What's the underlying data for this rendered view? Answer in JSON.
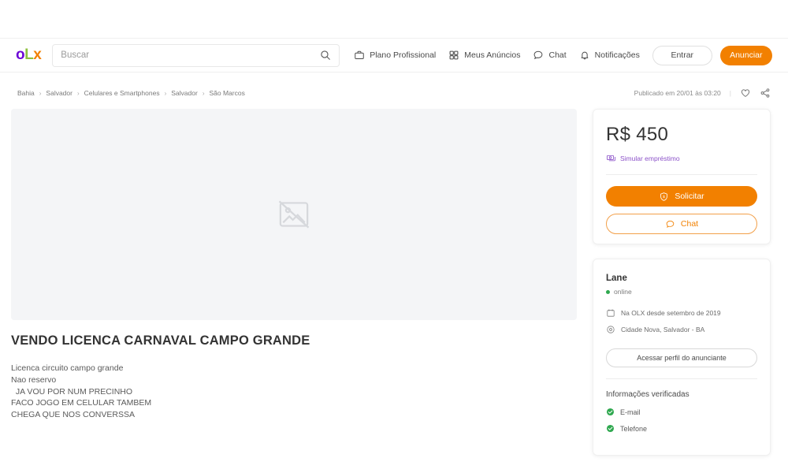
{
  "header": {
    "logo": {
      "part1": "o",
      "part2": "L",
      "part3": "x",
      "color1": "#6e0ad6",
      "color2": "#8ec13f",
      "color3": "#f28000"
    },
    "search": {
      "placeholder": "Buscar",
      "value": "",
      "icon": "search-icon"
    },
    "nav": [
      {
        "label": "Plano Profissional",
        "icon": "briefcase-icon"
      },
      {
        "label": "Meus Anúncios",
        "icon": "grid-icon"
      },
      {
        "label": "Chat",
        "icon": "chat-bubble-icon"
      },
      {
        "label": "Notificações",
        "icon": "bell-icon"
      }
    ],
    "login_label": "Entrar",
    "publish_label": "Anunciar",
    "publish_color": "#f28000"
  },
  "breadcrumb": {
    "items": [
      "Bahia",
      "Salvador",
      "Celulares e Smartphones",
      "Salvador",
      "São Marcos"
    ],
    "separator": "›"
  },
  "meta": {
    "published": "Publicado em 20/01 às 03:20",
    "divider": "|",
    "favorite_icon": "heart-icon",
    "share_icon": "share-icon"
  },
  "gallery": {
    "placeholder_icon": "broken-image-icon",
    "background": "#f4f5f7"
  },
  "ad": {
    "title": "VENDO LICENCA CARNAVAL CAMPO GRANDE",
    "description": "Licenca circuito campo grande\nNao reservo\n  JA VOU POR NUM PRECINHO\nFACO JOGO EM CELULAR TAMBEM\nCHEGA QUE NOS CONVERSSA"
  },
  "price_card": {
    "price": "R$ 450",
    "loan_link": "Simular empréstimo",
    "loan_icon": "money-icon",
    "loan_color": "#8c52c9",
    "request_label": "Solicitar",
    "request_icon": "shield-dollar-icon",
    "chat_label": "Chat",
    "chat_icon": "chat-bubble-icon"
  },
  "seller_card": {
    "name": "Lane",
    "status": "online",
    "status_color": "#2fa84f",
    "member_since": "Na OLX desde setembro de 2019",
    "member_since_icon": "calendar-icon",
    "location": "Cidade Nova, Salvador - BA",
    "location_icon": "map-pin-icon",
    "profile_button": "Acessar perfil do anunciante",
    "verified_title": "Informações verificadas",
    "verified_items": [
      {
        "label": "E-mail",
        "icon": "check-circle-icon"
      },
      {
        "label": "Telefone",
        "icon": "check-circle-icon"
      }
    ],
    "verified_color": "#2fa84f"
  }
}
